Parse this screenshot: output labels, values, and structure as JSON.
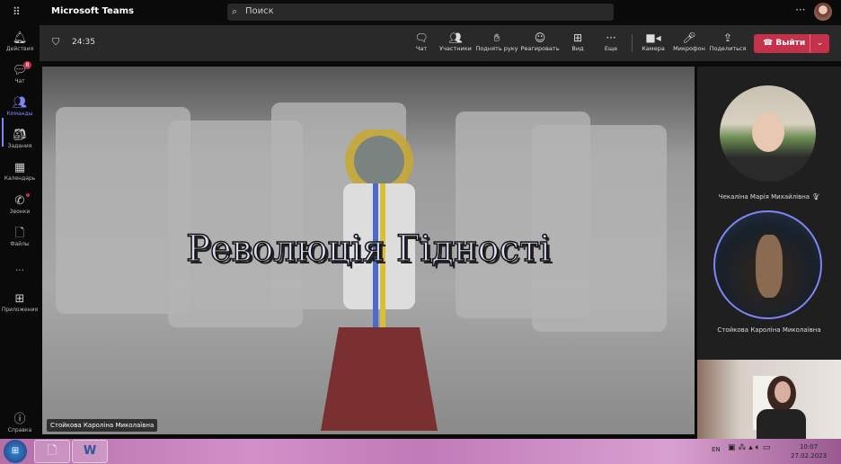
{
  "app": {
    "title": "Microsoft Teams",
    "search_placeholder": "Поиск"
  },
  "rail": [
    {
      "label": "Действия",
      "icon": "bell-icon"
    },
    {
      "label": "Чат",
      "icon": "chat-icon",
      "badge": "8"
    },
    {
      "label": "Команды",
      "icon": "teams-icon"
    },
    {
      "label": "Задания",
      "icon": "assignments-icon"
    },
    {
      "label": "Календарь",
      "icon": "calendar-icon"
    },
    {
      "label": "Звонки",
      "icon": "phone-icon"
    },
    {
      "label": "Файлы",
      "icon": "file-icon"
    },
    {
      "label": "...",
      "icon": "more-icon"
    },
    {
      "label": "Приложения",
      "icon": "apps-icon"
    },
    {
      "label": "Справка",
      "icon": "help-icon"
    }
  ],
  "meeting": {
    "timer": "24:35",
    "toolbar": [
      {
        "label": "Чат",
        "icon": "chat-icon"
      },
      {
        "label": "Участники",
        "icon": "people-icon"
      },
      {
        "label": "Поднять руку",
        "icon": "hand-icon"
      },
      {
        "label": "Реагировать",
        "icon": "smile-icon"
      },
      {
        "label": "Вид",
        "icon": "grid-icon"
      },
      {
        "label": "Еще",
        "icon": "more-icon"
      },
      {
        "label": "Камера",
        "icon": "camera-icon"
      },
      {
        "label": "Микрофон",
        "icon": "mic-icon"
      },
      {
        "label": "Поделиться",
        "icon": "share-icon"
      }
    ],
    "leave": "Выйти"
  },
  "stage": {
    "slide_title": "Революція Гідності",
    "presenter": "Стойкова Кароліна Миколаївна"
  },
  "participants": [
    {
      "name": "Чекаліна Марія Михайлівна",
      "muted": true
    },
    {
      "name": "Стойкова Кароліна Миколаївна",
      "speaking": true
    }
  ],
  "taskbar": {
    "lang": "EN",
    "time": "10:07",
    "date": "27.02.2023"
  },
  "colors": {
    "accent": "#7f85f5",
    "leave": "#c4314b"
  }
}
